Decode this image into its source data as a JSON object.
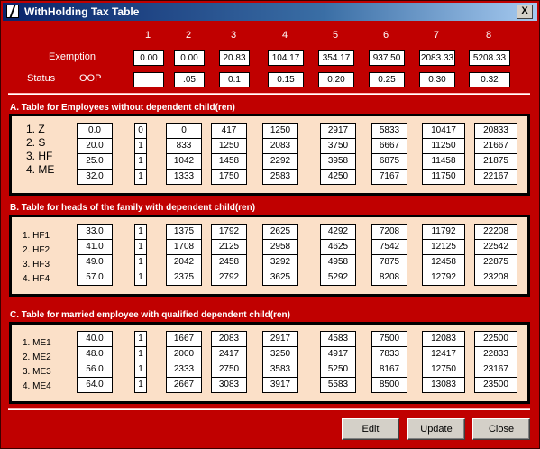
{
  "window": {
    "title": "WithHolding Tax Table",
    "close_glyph": "X"
  },
  "header": {
    "columns": [
      "1",
      "2",
      "3",
      "4",
      "5",
      "6",
      "7",
      "8"
    ],
    "exemption_label": "Exemption",
    "status_label": "Status",
    "oop_label": "OOP",
    "exemption_values": [
      "0.00",
      "0.00",
      "20.83",
      "104.17",
      "354.17",
      "937.50",
      "2083.33",
      "5208.33"
    ],
    "oop_values": [
      "",
      ".05",
      "0.1",
      "0.15",
      "0.20",
      "0.25",
      "0.30",
      "0.32"
    ]
  },
  "sections": [
    {
      "title": "A. Table for Employees without dependent child(ren)",
      "row_labels": [
        "1. Z",
        "2. S",
        "3. HF",
        "4. ME"
      ],
      "columns": [
        [
          "0.0",
          "20.0",
          "25.0",
          "32.0"
        ],
        [
          "0",
          "1",
          "1",
          "1"
        ],
        [
          "0",
          "833",
          "1042",
          "1333"
        ],
        [
          "417",
          "1250",
          "1458",
          "1750"
        ],
        [
          "1250",
          "2083",
          "2292",
          "2583"
        ],
        [
          "2917",
          "3750",
          "3958",
          "4250"
        ],
        [
          "5833",
          "6667",
          "6875",
          "7167"
        ],
        [
          "10417",
          "11250",
          "11458",
          "11750"
        ],
        [
          "20833",
          "21667",
          "21875",
          "22167"
        ]
      ]
    },
    {
      "title": "B. Table for heads of the family with dependent child(ren)",
      "row_labels": [
        "1. HF1",
        "2. HF2",
        "3. HF3",
        "4. HF4"
      ],
      "columns": [
        [
          "33.0",
          "41.0",
          "49.0",
          "57.0"
        ],
        [
          "1",
          "1",
          "1",
          "1"
        ],
        [
          "1375",
          "1708",
          "2042",
          "2375"
        ],
        [
          "1792",
          "2125",
          "2458",
          "2792"
        ],
        [
          "2625",
          "2958",
          "3292",
          "3625"
        ],
        [
          "4292",
          "4625",
          "4958",
          "5292"
        ],
        [
          "7208",
          "7542",
          "7875",
          "8208"
        ],
        [
          "11792",
          "12125",
          "12458",
          "12792"
        ],
        [
          "22208",
          "22542",
          "22875",
          "23208"
        ]
      ]
    },
    {
      "title": "C. Table for married employee with qualified dependent child(ren)",
      "row_labels": [
        "1. ME1",
        "2. ME2",
        "3. ME3",
        "4. ME4"
      ],
      "columns": [
        [
          "40.0",
          "48.0",
          "56.0",
          "64.0"
        ],
        [
          "1",
          "1",
          "1",
          "1"
        ],
        [
          "1667",
          "2000",
          "2333",
          "2667"
        ],
        [
          "2083",
          "2417",
          "2750",
          "3083"
        ],
        [
          "2917",
          "3250",
          "3583",
          "3917"
        ],
        [
          "4583",
          "4917",
          "5250",
          "5583"
        ],
        [
          "7500",
          "7833",
          "8167",
          "8500"
        ],
        [
          "12083",
          "12417",
          "12750",
          "13083"
        ],
        [
          "22500",
          "22833",
          "23167",
          "23500"
        ]
      ]
    }
  ],
  "buttons": {
    "edit": "Edit",
    "update": "Update",
    "close": "Close"
  },
  "colors": {
    "background": "#c00000",
    "panel": "#fbe0c8",
    "titlebar_start": "#0a246a"
  }
}
